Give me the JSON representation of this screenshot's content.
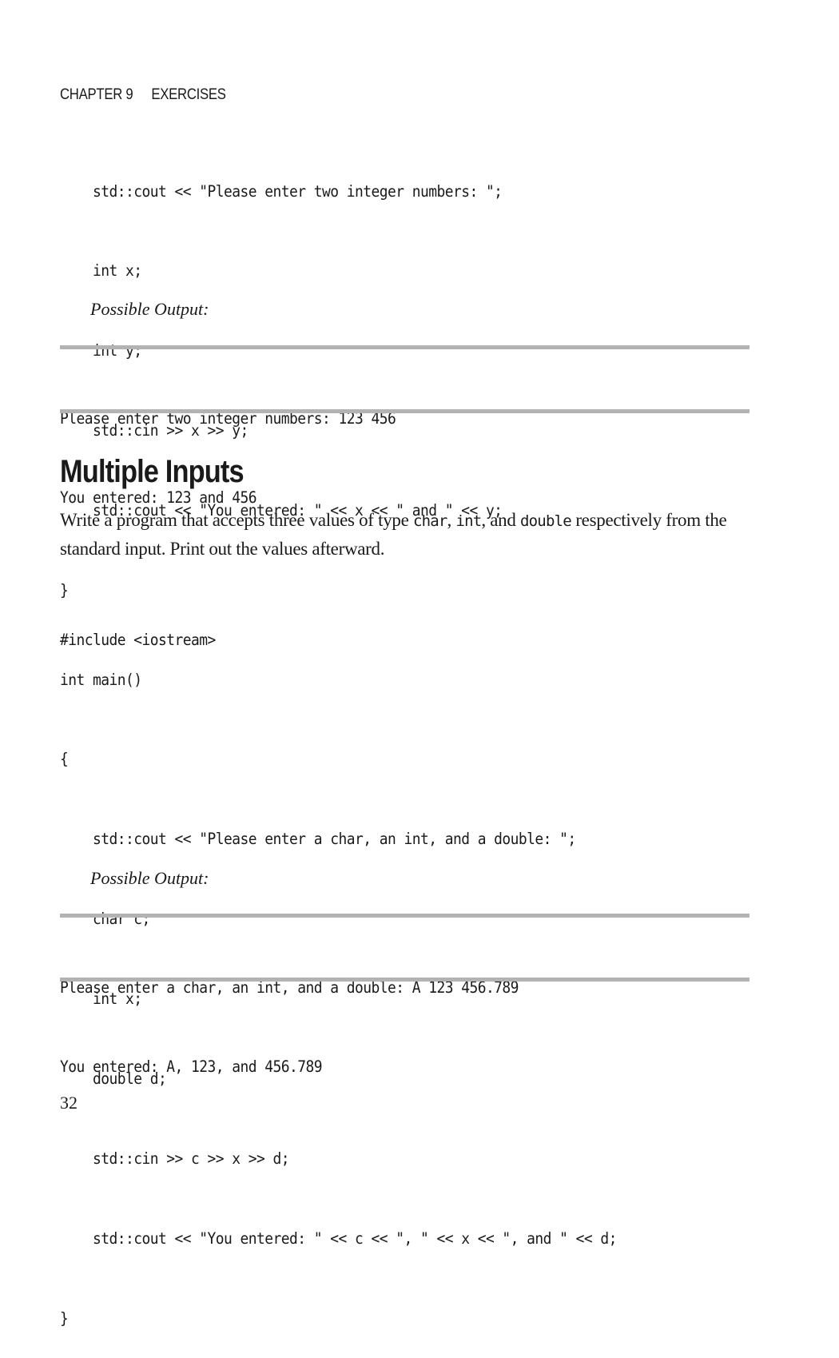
{
  "running_head": {
    "chapter": "CHAPTER 9",
    "section": "EXERCISES"
  },
  "code_top": [
    "    std::cout << \"Please enter two integer numbers: \";",
    "    int x;",
    "    int y;",
    "    std::cin >> x >> y;",
    "    std::cout << \"You entered: \" << x << \" and \" << y;",
    "}"
  ],
  "caption_1": "Possible Output:",
  "output_1": [
    "Please enter two integer numbers: 123 456",
    "You entered: 123 and 456"
  ],
  "section_heading": "Multiple Inputs",
  "paragraph": {
    "part1": "Write a program that accepts three values of type ",
    "code1": "char",
    "part2": ", ",
    "code2": "int",
    "part3": ", and ",
    "code3": "double",
    "part4": " respectively from the standard input. Print out the values afterward."
  },
  "include_line": "#include <iostream>",
  "code_main": [
    "int main()",
    "{",
    "    std::cout << \"Please enter a char, an int, and a double: \";",
    "    char c;",
    "    int x;",
    "    double d;",
    "    std::cin >> c >> x >> d;",
    "    std::cout << \"You entered: \" << c << \", \" << x << \", and \" << d;",
    "}"
  ],
  "caption_2": "Possible Output:",
  "output_2": [
    "Please enter a char, an int, and a double: A 123 456.789",
    "You entered: A, 123, and 456.789"
  ],
  "page_number": "32"
}
